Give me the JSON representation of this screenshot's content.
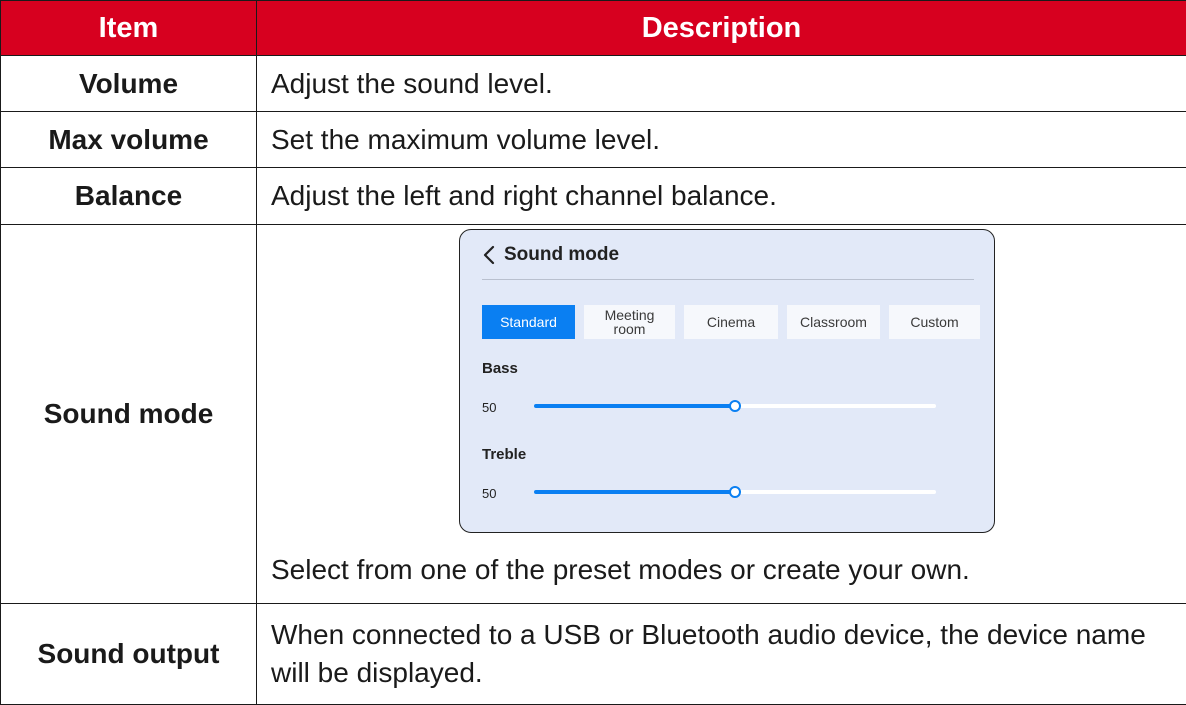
{
  "header": {
    "item": "Item",
    "description": "Description"
  },
  "rows": [
    {
      "item": "Volume",
      "description": "Adjust the sound level."
    },
    {
      "item": "Max volume",
      "description": "Set the maximum volume level."
    },
    {
      "item": "Balance",
      "description": "Adjust the left and right channel balance."
    },
    {
      "item": "Sound mode",
      "description": "Select from one of the preset modes or create your own."
    },
    {
      "item": "Sound output",
      "description": "When connected to a USB or Bluetooth audio device, the device name will be displayed."
    }
  ],
  "panel": {
    "title": "Sound mode",
    "modes": [
      "Standard",
      "Meeting room",
      "Cinema",
      "Classroom",
      "Custom"
    ],
    "selected_mode": "Standard",
    "bass": {
      "label": "Bass",
      "value": "50",
      "level": 0.5
    },
    "treble": {
      "label": "Treble",
      "value": "50",
      "level": 0.5
    }
  },
  "colors": {
    "header_bg": "#d7001f",
    "accent": "#0a7ff2",
    "panel_bg": "#e2e9f8"
  },
  "icons": {
    "back": "chevron-left-icon"
  }
}
